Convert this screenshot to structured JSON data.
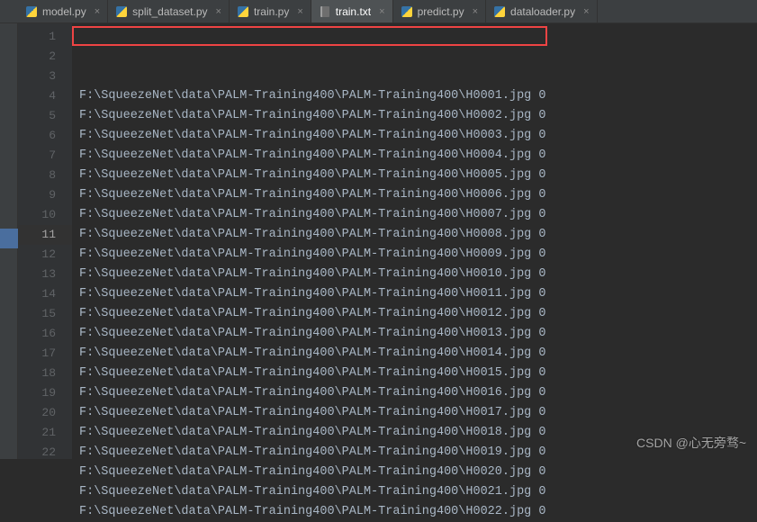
{
  "tabs": [
    {
      "label": "model.py",
      "type": "py",
      "active": false
    },
    {
      "label": "split_dataset.py",
      "type": "py",
      "active": false
    },
    {
      "label": "train.py",
      "type": "py",
      "active": false
    },
    {
      "label": "train.txt",
      "type": "txt",
      "active": true
    },
    {
      "label": "predict.py",
      "type": "py",
      "active": false
    },
    {
      "label": "dataloader.py",
      "type": "py",
      "active": false
    }
  ],
  "lines": [
    {
      "num": 1,
      "text": "F:\\SqueezeNet\\data\\PALM-Training400\\PALM-Training400\\H0001.jpg 0"
    },
    {
      "num": 2,
      "text": "F:\\SqueezeNet\\data\\PALM-Training400\\PALM-Training400\\H0002.jpg 0"
    },
    {
      "num": 3,
      "text": "F:\\SqueezeNet\\data\\PALM-Training400\\PALM-Training400\\H0003.jpg 0"
    },
    {
      "num": 4,
      "text": "F:\\SqueezeNet\\data\\PALM-Training400\\PALM-Training400\\H0004.jpg 0"
    },
    {
      "num": 5,
      "text": "F:\\SqueezeNet\\data\\PALM-Training400\\PALM-Training400\\H0005.jpg 0"
    },
    {
      "num": 6,
      "text": "F:\\SqueezeNet\\data\\PALM-Training400\\PALM-Training400\\H0006.jpg 0"
    },
    {
      "num": 7,
      "text": "F:\\SqueezeNet\\data\\PALM-Training400\\PALM-Training400\\H0007.jpg 0"
    },
    {
      "num": 8,
      "text": "F:\\SqueezeNet\\data\\PALM-Training400\\PALM-Training400\\H0008.jpg 0"
    },
    {
      "num": 9,
      "text": "F:\\SqueezeNet\\data\\PALM-Training400\\PALM-Training400\\H0009.jpg 0"
    },
    {
      "num": 10,
      "text": "F:\\SqueezeNet\\data\\PALM-Training400\\PALM-Training400\\H0010.jpg 0"
    },
    {
      "num": 11,
      "text": "F:\\SqueezeNet\\data\\PALM-Training400\\PALM-Training400\\H0011.jpg 0"
    },
    {
      "num": 12,
      "text": "F:\\SqueezeNet\\data\\PALM-Training400\\PALM-Training400\\H0012.jpg 0"
    },
    {
      "num": 13,
      "text": "F:\\SqueezeNet\\data\\PALM-Training400\\PALM-Training400\\H0013.jpg 0"
    },
    {
      "num": 14,
      "text": "F:\\SqueezeNet\\data\\PALM-Training400\\PALM-Training400\\H0014.jpg 0"
    },
    {
      "num": 15,
      "text": "F:\\SqueezeNet\\data\\PALM-Training400\\PALM-Training400\\H0015.jpg 0"
    },
    {
      "num": 16,
      "text": "F:\\SqueezeNet\\data\\PALM-Training400\\PALM-Training400\\H0016.jpg 0"
    },
    {
      "num": 17,
      "text": "F:\\SqueezeNet\\data\\PALM-Training400\\PALM-Training400\\H0017.jpg 0"
    },
    {
      "num": 18,
      "text": "F:\\SqueezeNet\\data\\PALM-Training400\\PALM-Training400\\H0018.jpg 0"
    },
    {
      "num": 19,
      "text": "F:\\SqueezeNet\\data\\PALM-Training400\\PALM-Training400\\H0019.jpg 0"
    },
    {
      "num": 20,
      "text": "F:\\SqueezeNet\\data\\PALM-Training400\\PALM-Training400\\H0020.jpg 0"
    },
    {
      "num": 21,
      "text": "F:\\SqueezeNet\\data\\PALM-Training400\\PALM-Training400\\H0021.jpg 0"
    },
    {
      "num": 22,
      "text": "F:\\SqueezeNet\\data\\PALM-Training400\\PALM-Training400\\H0022.jpg 0"
    }
  ],
  "highlighted_gutter_line": 11,
  "watermark": "CSDN @心无旁骛~"
}
